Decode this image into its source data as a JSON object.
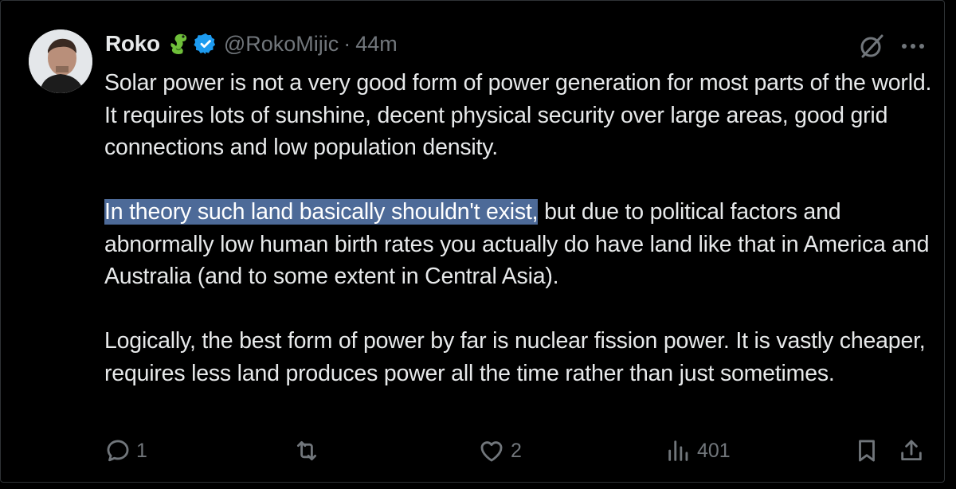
{
  "author": {
    "name": "Roko",
    "handle": "@RokoMijic",
    "separator": "·",
    "time": "44m",
    "badge_emoji": "dragon-emoji",
    "verified": "verified-badge-icon"
  },
  "body": {
    "paragraph_1": "Solar power is not a very good form of power generation for most parts of the world. It requires lots of sunshine, decent physical security over large areas, good grid connections and low population density.",
    "paragraph_2_highlighted": "In theory such land basically shouldn't exist,",
    "paragraph_2_rest": " but due to political factors and abnormally low human birth rates you actually do have land like that in America and Australia (and to some extent in Central Asia).",
    "paragraph_3": "Logically, the best form of power by far is nuclear fission power. It is vastly cheaper, requires less land produces power all the time rather than just sometimes."
  },
  "actions": {
    "replies": "1",
    "reposts": "",
    "likes": "2",
    "views": "401"
  },
  "colors": {
    "background": "#000000",
    "text": "#e7e9ea",
    "muted": "#71767b",
    "verified": "#1d9bf0",
    "highlight": "#4d6a98"
  }
}
